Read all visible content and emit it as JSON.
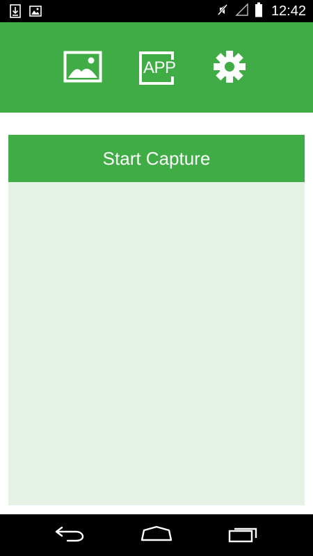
{
  "status_bar": {
    "time": "12:42",
    "icons": [
      "download-icon",
      "image-notification-icon",
      "mute-icon",
      "signal-icon",
      "battery-icon"
    ]
  },
  "toolbar": {
    "app_label": "APP",
    "icons": [
      "gallery-icon",
      "app-capture-icon",
      "settings-gear-icon"
    ]
  },
  "main": {
    "start_button_label": "Start Capture"
  },
  "navigation": {
    "icons": [
      "back-icon",
      "home-icon",
      "recents-icon"
    ]
  },
  "colors": {
    "primary": "#3fac45",
    "card_background": "#e4f3e6",
    "system_bar": "#000000"
  }
}
